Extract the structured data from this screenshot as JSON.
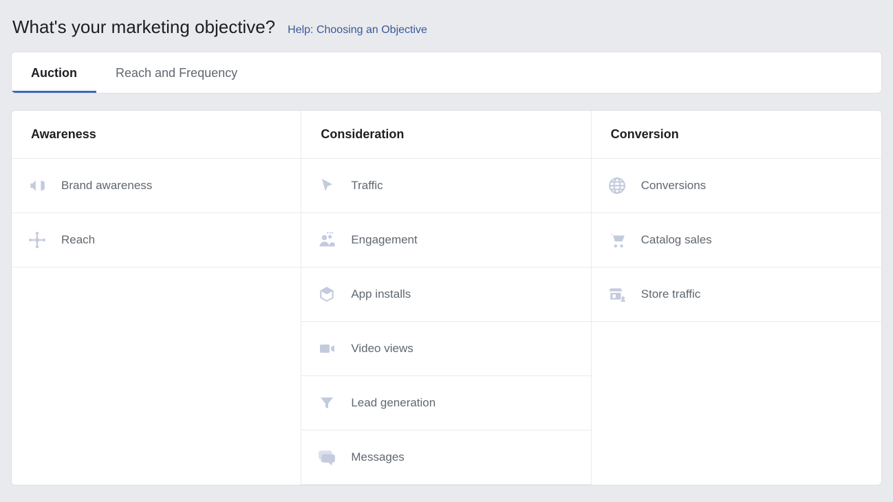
{
  "header": {
    "title": "What's your marketing objective?",
    "help_link": "Help: Choosing an Objective"
  },
  "tabs": [
    {
      "label": "Auction",
      "active": true
    },
    {
      "label": "Reach and Frequency",
      "active": false
    }
  ],
  "columns": {
    "awareness": {
      "header": "Awareness",
      "options": [
        {
          "icon": "megaphone-icon",
          "label": "Brand awareness"
        },
        {
          "icon": "reach-icon",
          "label": "Reach"
        }
      ]
    },
    "consideration": {
      "header": "Consideration",
      "options": [
        {
          "icon": "cursor-icon",
          "label": "Traffic"
        },
        {
          "icon": "people-icon",
          "label": "Engagement"
        },
        {
          "icon": "box-icon",
          "label": "App installs"
        },
        {
          "icon": "video-icon",
          "label": "Video views"
        },
        {
          "icon": "funnel-icon",
          "label": "Lead generation"
        },
        {
          "icon": "chat-icon",
          "label": "Messages"
        }
      ]
    },
    "conversion": {
      "header": "Conversion",
      "options": [
        {
          "icon": "globe-icon",
          "label": "Conversions"
        },
        {
          "icon": "cart-icon",
          "label": "Catalog sales"
        },
        {
          "icon": "store-icon",
          "label": "Store traffic"
        }
      ]
    }
  }
}
